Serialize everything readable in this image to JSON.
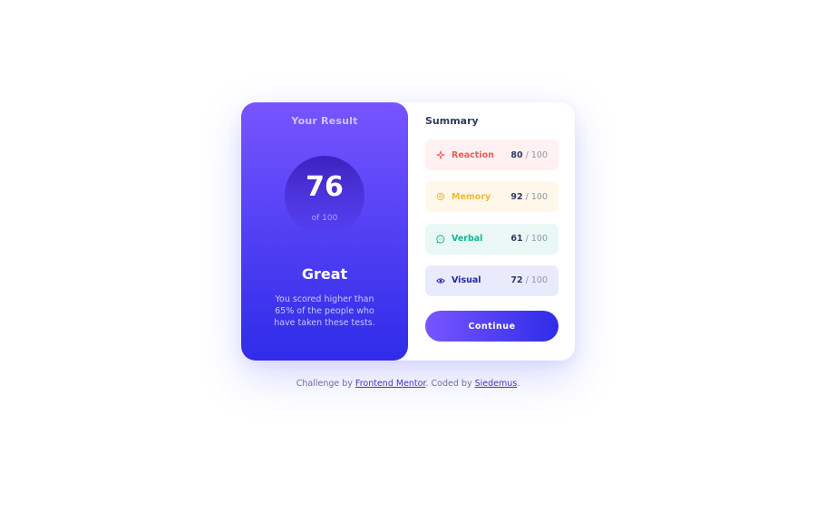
{
  "result": {
    "heading": "Your Result",
    "score": "76",
    "score_max": "of 100",
    "grade": "Great",
    "description": "You scored higher than 65% of the people who have taken these tests."
  },
  "summary": {
    "title": "Summary",
    "items": [
      {
        "label": "Reaction",
        "score": "80",
        "max": "/ 100",
        "color": "#f05a5a",
        "bg": "#fff1f1",
        "icon": "lightning-icon"
      },
      {
        "label": "Memory",
        "score": "92",
        "max": "/ 100",
        "color": "#f0b933",
        "bg": "#fff8ea",
        "icon": "brain-icon"
      },
      {
        "label": "Verbal",
        "score": "61",
        "max": "/ 100",
        "color": "#12b593",
        "bg": "#eaf8f5",
        "icon": "chat-bubble-icon"
      },
      {
        "label": "Visual",
        "score": "72",
        "max": "/ 100",
        "color": "#1f2a9c",
        "bg": "#e9eafc",
        "icon": "eye-icon"
      }
    ],
    "button_label": "Continue"
  },
  "footer": {
    "prefix": "Challenge by ",
    "link1": "Frontend Mentor",
    "middle": ". Coded by ",
    "link2": "Siedemus",
    "suffix": "."
  },
  "colors": {
    "gradient_start": "#7755ff",
    "gradient_end": "#2f2ce9",
    "text_dark": "#303b5a"
  }
}
